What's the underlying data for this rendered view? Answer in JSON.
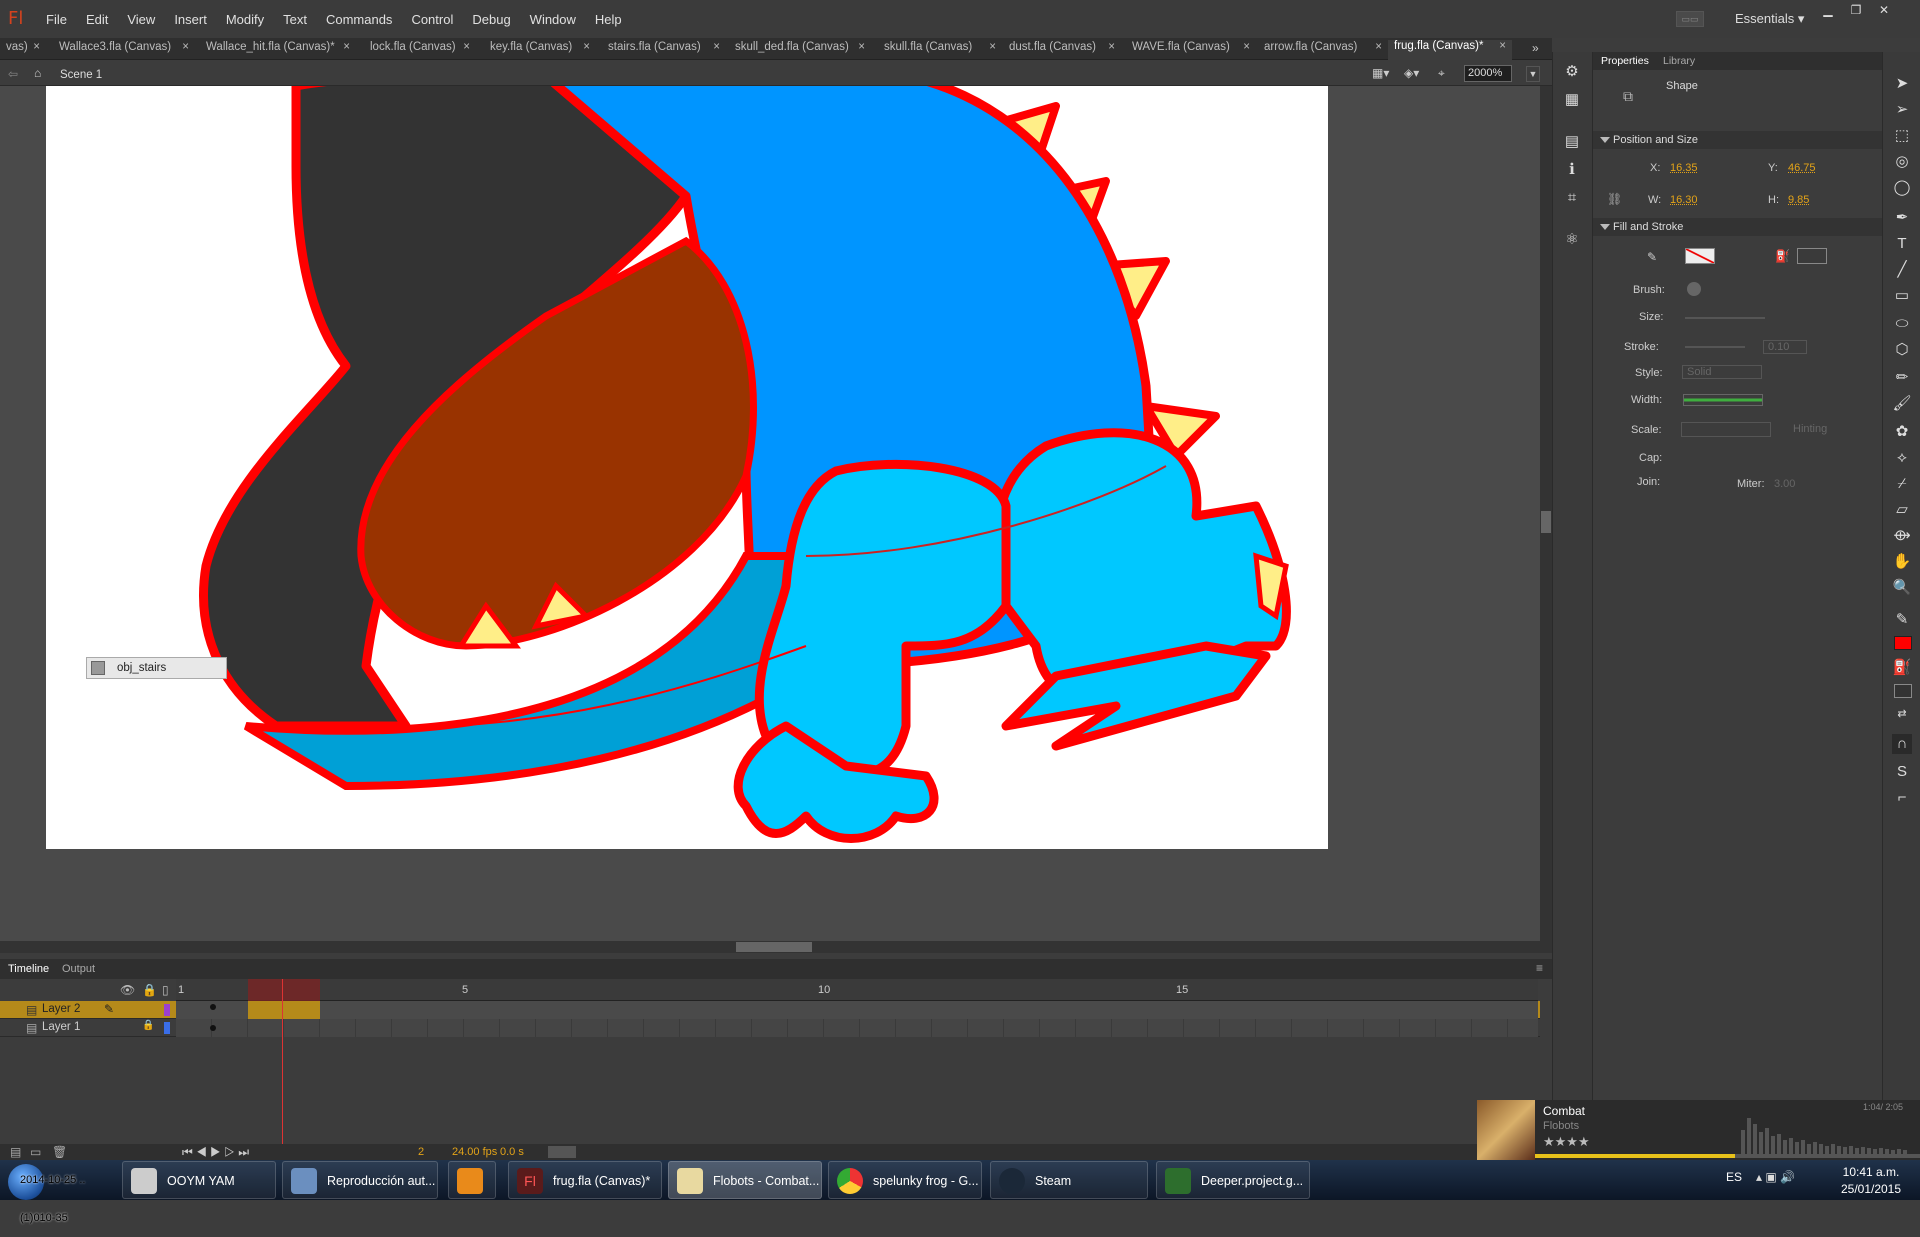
{
  "app": {
    "logo": "Fl",
    "menus": [
      "File",
      "Edit",
      "View",
      "Insert",
      "Modify",
      "Text",
      "Commands",
      "Control",
      "Debug",
      "Window",
      "Help"
    ],
    "workspace": "Essentials",
    "workspace_icon": "workspace-switcher-icon"
  },
  "tabs": [
    {
      "label": "vas)",
      "active": false
    },
    {
      "label": "Wallace3.fla (Canvas)",
      "active": false
    },
    {
      "label": "Wallace_hit.fla (Canvas)*",
      "active": false
    },
    {
      "label": "lock.fla (Canvas)",
      "active": false
    },
    {
      "label": "key.fla (Canvas)",
      "active": false
    },
    {
      "label": "stairs.fla (Canvas)",
      "active": false
    },
    {
      "label": "skull_ded.fla (Canvas)",
      "active": false
    },
    {
      "label": "skull.fla (Canvas)",
      "active": false
    },
    {
      "label": "dust.fla (Canvas)",
      "active": false
    },
    {
      "label": "WAVE.fla (Canvas)",
      "active": false
    },
    {
      "label": "arrow.fla (Canvas)",
      "active": false
    },
    {
      "label": "frug.fla (Canvas)*",
      "active": true
    }
  ],
  "editbar": {
    "scene": "Scene 1",
    "zoom": "2000%"
  },
  "stage": {
    "tooltip": "obj_stairs"
  },
  "timeline": {
    "tabs": [
      "Timeline",
      "Output"
    ],
    "ruler": [
      "1",
      "5",
      "10",
      "15"
    ],
    "layers": [
      {
        "name": "Layer 2",
        "selected": true,
        "color": "#9b3fd0"
      },
      {
        "name": "Layer 1",
        "selected": false,
        "color": "#3a6ee8"
      }
    ],
    "current_frame": "2",
    "fps": "24.00 fps",
    "time": "0.0 s"
  },
  "props": {
    "tabs": [
      "Properties",
      "Library"
    ],
    "type": "Shape",
    "position": {
      "title": "Position and Size",
      "x_label": "X:",
      "x": "16.35",
      "y_label": "Y:",
      "y": "46.75",
      "w_label": "W:",
      "w": "16.30",
      "h_label": "H:",
      "h": "9.85"
    },
    "fill": {
      "title": "Fill and Stroke",
      "brush": "Brush:",
      "size": "Size:",
      "stroke": "Stroke:",
      "stroke_val": "0.10",
      "style": "Style:",
      "style_val": "Solid",
      "width": "Width:",
      "scale": "Scale:",
      "hinting": "Hinting",
      "cap": "Cap:",
      "join": "Join:",
      "miter": "Miter:",
      "miter_val": "3.00"
    }
  },
  "media": {
    "title": "Combat",
    "artist": "Flobots",
    "time": "1:04/ 2:05"
  },
  "taskbar": {
    "items": [
      "2014-10-25 ..(1)010-35",
      "OOYM YAM",
      "Reproducción aut...",
      "",
      "frug.fla (Canvas)*",
      "Flobots - Combat...",
      "spelunky frog - G...",
      "Steam",
      "Deeper.project.g..."
    ],
    "lang": "ES",
    "time": "10:41 a.m.",
    "date": "25/01/2015"
  },
  "colors": {
    "accent": "#e3a318",
    "stroke": "#ff0000",
    "body": "#0095ff",
    "leg": "#00c8ff",
    "dark": "#333333",
    "mouth": "#993300",
    "belly": "#00a0d6"
  }
}
